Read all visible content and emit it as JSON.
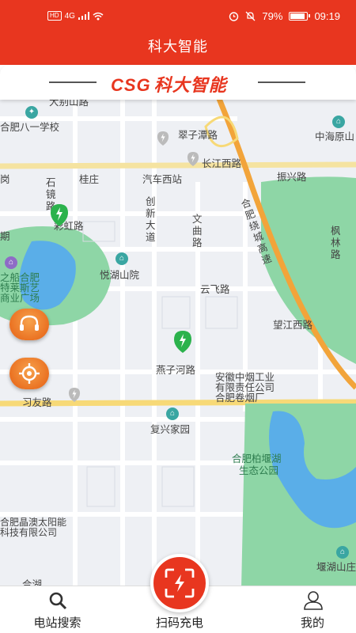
{
  "status_bar": {
    "hd": "HD",
    "network": "4G",
    "battery": "79%",
    "battery_level": 0.79,
    "time": "09:19"
  },
  "header": {
    "title": "科大智能",
    "brand_latin": "CSG",
    "brand_cn": "科大智能"
  },
  "map": {
    "labels": {
      "dabieshan": "大别山路",
      "bayi": "合肥八一学校",
      "zhongpu": "中海原山",
      "ziyuntan": "翠子潭路",
      "changjiangxi": "长江西路",
      "zhenxing": "振兴路",
      "gang": "岗",
      "guizhuang": "桂庄",
      "qichexizhan": "汽车西站",
      "qi": "期",
      "caihong": "彩虹路",
      "yuehu": "悦湖山院",
      "yunfei": "云飞路",
      "wangjiangxi": "望江西路",
      "yanzihe": "燕子河路",
      "xiyou": "习友路",
      "fuxing": "复兴家园",
      "tobacco1": "安徽中烟工业",
      "tobacco2": "有限责任公司",
      "tobacco3": "合肥卷烟厂",
      "bai_lake1": "合肥柏堰湖",
      "bai_lake2": "生态公园",
      "jingao1": "合肥晶澳太阳能",
      "jingao2": "科技有限公司",
      "yanhu": "堰湖山庄",
      "mall1": "之船合肥",
      "mall2": "特莱斯艺",
      "mall3": "商业广场",
      "shijing": "石镜路",
      "chuangxin": "创新大道",
      "wenqu": "文曲路",
      "raocheng": "合肥绕城高速",
      "fenglin": "枫林路",
      "hehu": "合湖"
    }
  },
  "bottom_nav": {
    "search_label": "电站搜索",
    "scan_label": "扫码充电",
    "mine_label": "我的"
  },
  "colors": {
    "brand_red": "#e8361f",
    "accent_orange": "#e55e12",
    "park_green": "#8ed6a6",
    "water_blue": "#5aaee8",
    "highway": "#f2a43a"
  }
}
